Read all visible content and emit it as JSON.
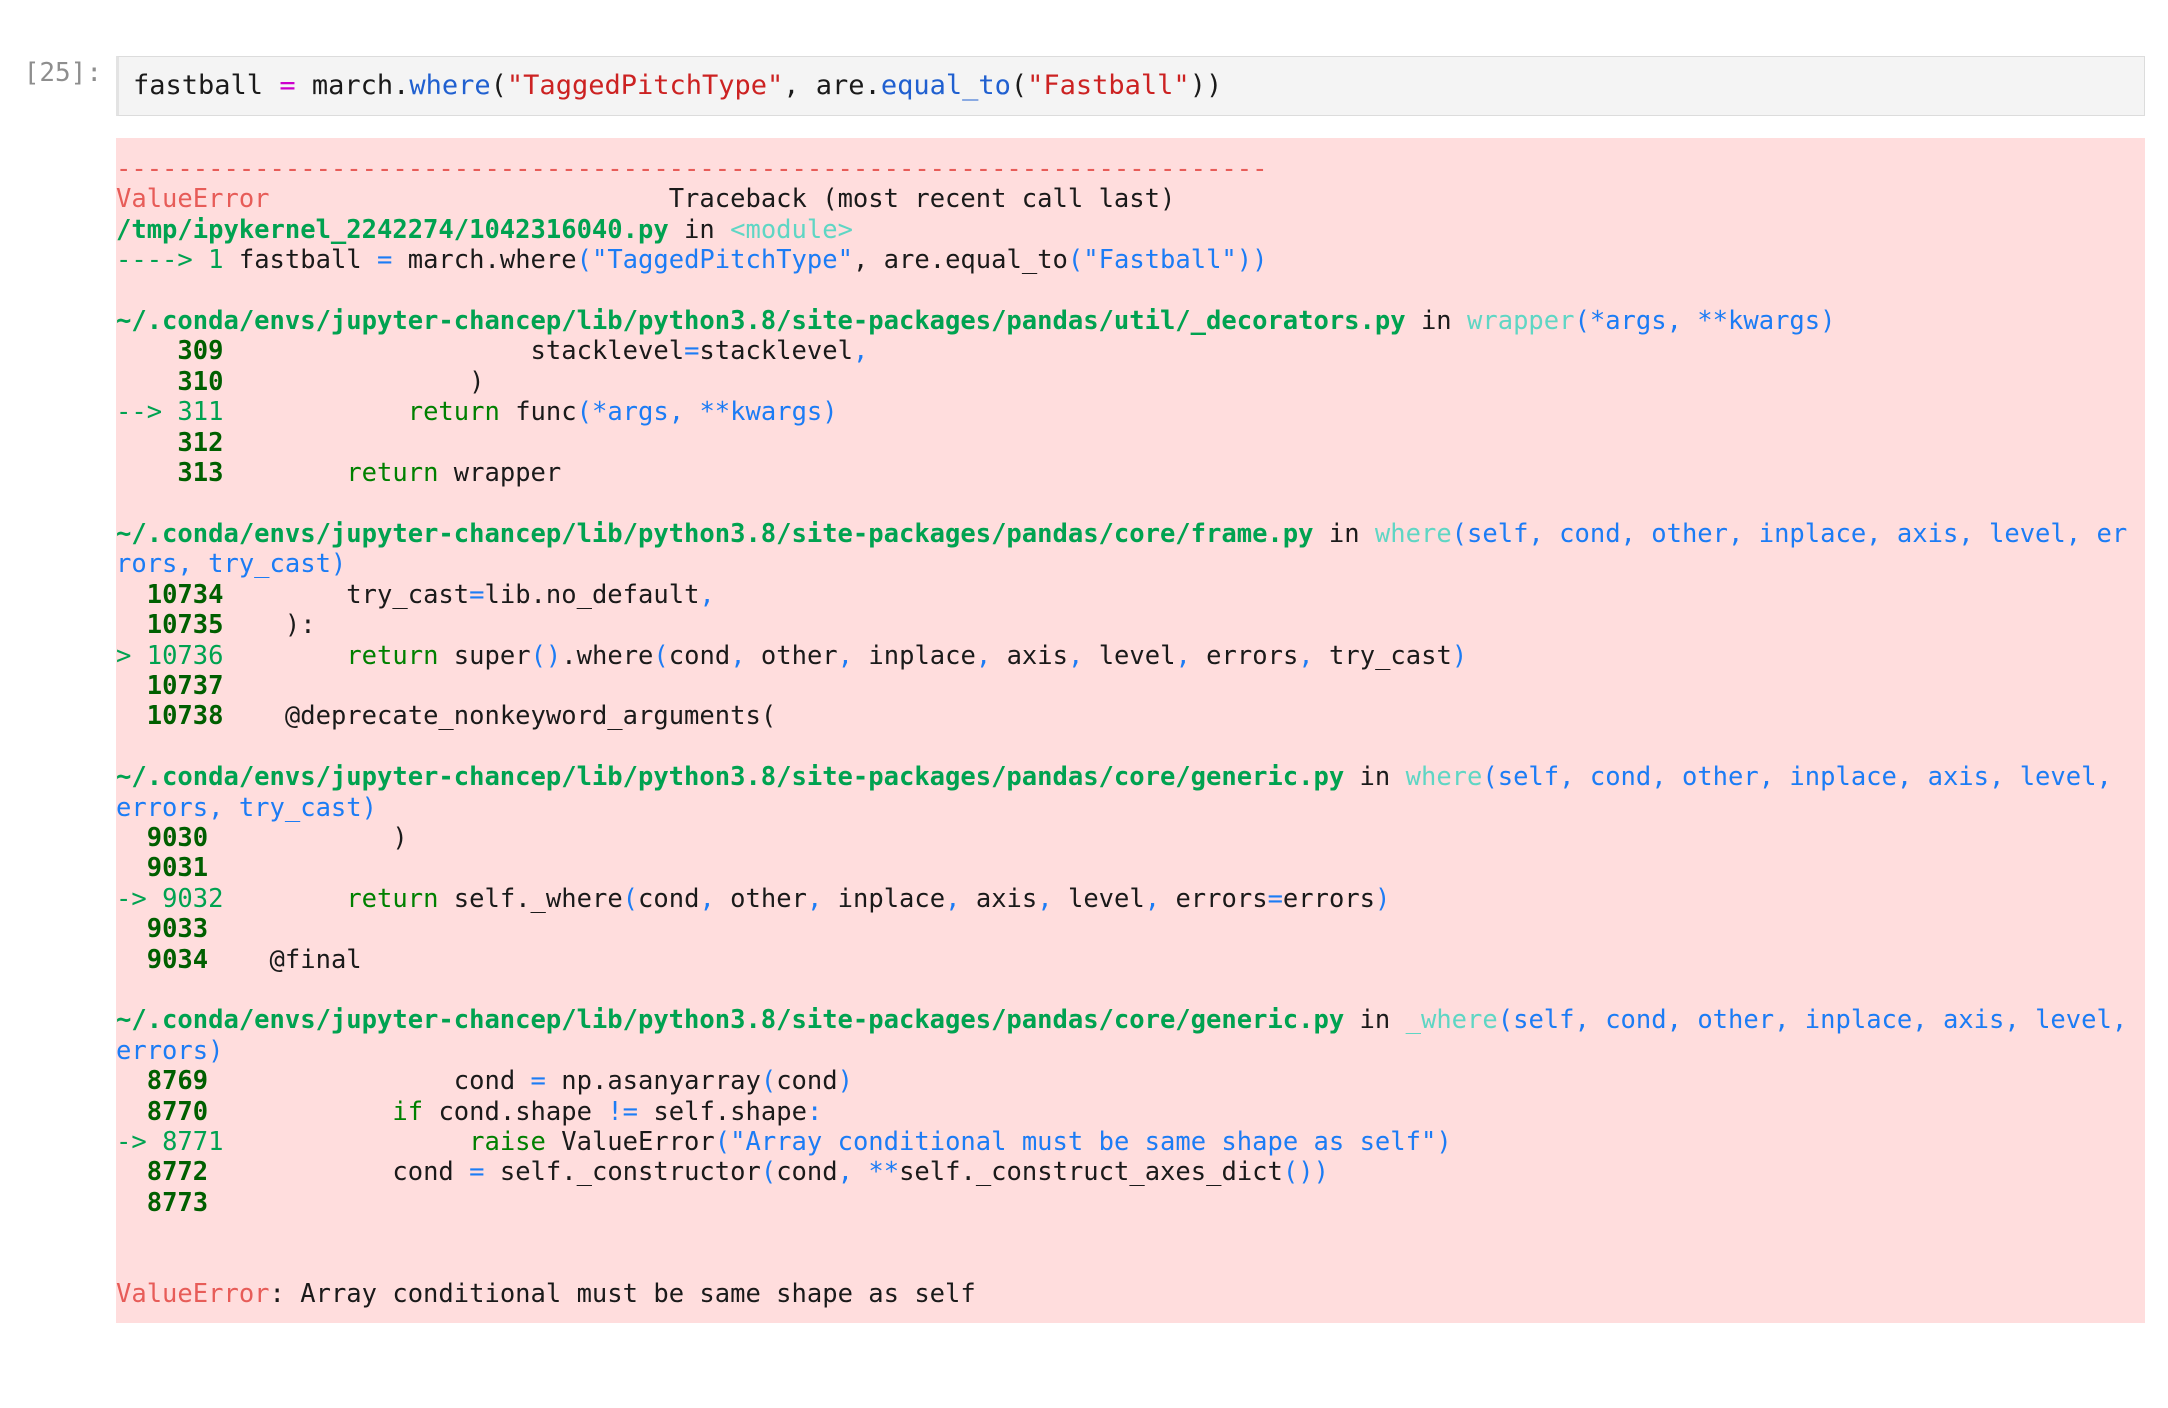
{
  "cell": {
    "prompt": "[25]:",
    "input_code": "fastball = march.where(\"TaggedPitchType\", are.equal_to(\"Fastball\"))",
    "input_tokens": [
      {
        "t": "fastball ",
        "c": "plain"
      },
      {
        "t": "=",
        "c": "magenta"
      },
      {
        "t": " march.",
        "c": "plain"
      },
      {
        "t": "where",
        "c": "kwblue"
      },
      {
        "t": "(",
        "c": "plain"
      },
      {
        "t": "\"TaggedPitchType\"",
        "c": "strred"
      },
      {
        "t": ", are.",
        "c": "plain"
      },
      {
        "t": "equal_to",
        "c": "kwblue"
      },
      {
        "t": "(",
        "c": "plain"
      },
      {
        "t": "\"Fastball\"",
        "c": "strred"
      },
      {
        "t": "))",
        "c": "plain"
      }
    ]
  },
  "traceback": {
    "rule": "---------------------------------------------------------------------------",
    "exception_type": "ValueError",
    "header_right": "Traceback (most recent call last)",
    "final_error_label": "ValueError",
    "final_error_message": ": Array conditional must be same shape as self",
    "frames": [
      {
        "path": "/tmp/ipykernel_2242274/1042316040.py",
        "in_word": " in ",
        "func": "<module>",
        "signature": "",
        "lines": [
          {
            "marker": "----> ",
            "no": "1",
            "current": true,
            "tokens": [
              {
                "t": " fastball ",
                "c": "plain"
              },
              {
                "t": "=",
                "c": "op"
              },
              {
                "t": " march.where",
                "c": "plain"
              },
              {
                "t": "(",
                "c": "op"
              },
              {
                "t": "\"TaggedPitchType\"",
                "c": "arg"
              },
              {
                "t": ", are.equal_to",
                "c": "plain"
              },
              {
                "t": "(",
                "c": "op"
              },
              {
                "t": "\"Fastball\"",
                "c": "arg"
              },
              {
                "t": "))",
                "c": "op"
              }
            ]
          }
        ]
      },
      {
        "path": "~/.conda/envs/jupyter-chancep/lib/python3.8/site-packages/pandas/util/_decorators.py",
        "in_word": " in ",
        "func": "wrapper",
        "signature": "(*args, **kwargs)",
        "lines": [
          {
            "marker": "    ",
            "no": "309",
            "current": false,
            "tokens": [
              {
                "t": "                    stacklevel",
                "c": "plain"
              },
              {
                "t": "=",
                "c": "op"
              },
              {
                "t": "stacklevel",
                "c": "plain"
              },
              {
                "t": ",",
                "c": "op"
              }
            ]
          },
          {
            "marker": "    ",
            "no": "310",
            "current": false,
            "tokens": [
              {
                "t": "                )",
                "c": "plain"
              }
            ]
          },
          {
            "marker": "--> ",
            "no": "311",
            "current": true,
            "tokens": [
              {
                "t": "            ",
                "c": "plain"
              },
              {
                "t": "return",
                "c": "kw"
              },
              {
                "t": " func",
                "c": "plain"
              },
              {
                "t": "(",
                "c": "op"
              },
              {
                "t": "*args",
                "c": "arg"
              },
              {
                "t": ", ",
                "c": "op"
              },
              {
                "t": "**kwargs",
                "c": "arg"
              },
              {
                "t": ")",
                "c": "op"
              }
            ]
          },
          {
            "marker": "    ",
            "no": "312",
            "current": false,
            "tokens": []
          },
          {
            "marker": "    ",
            "no": "313",
            "current": false,
            "tokens": [
              {
                "t": "        ",
                "c": "plain"
              },
              {
                "t": "return",
                "c": "kw"
              },
              {
                "t": " wrapper",
                "c": "plain"
              }
            ]
          }
        ]
      },
      {
        "path": "~/.conda/envs/jupyter-chancep/lib/python3.8/site-packages/pandas/core/frame.py",
        "in_word": " in ",
        "func": "where",
        "signature": "(self, cond, other, inplace, axis, level, errors, try_cast)",
        "lines": [
          {
            "marker": "  ",
            "no": "10734",
            "current": false,
            "tokens": [
              {
                "t": "        try_cast",
                "c": "plain"
              },
              {
                "t": "=",
                "c": "op"
              },
              {
                "t": "lib.no_default",
                "c": "plain"
              },
              {
                "t": ",",
                "c": "op"
              }
            ]
          },
          {
            "marker": "  ",
            "no": "10735",
            "current": false,
            "tokens": [
              {
                "t": "    ):",
                "c": "plain"
              }
            ]
          },
          {
            "marker": "> ",
            "no": "10736",
            "current": true,
            "tokens": [
              {
                "t": "        ",
                "c": "plain"
              },
              {
                "t": "return",
                "c": "kw"
              },
              {
                "t": " super",
                "c": "plain"
              },
              {
                "t": "()",
                "c": "op"
              },
              {
                "t": ".where",
                "c": "plain"
              },
              {
                "t": "(",
                "c": "op"
              },
              {
                "t": "cond",
                "c": "plain"
              },
              {
                "t": ",",
                "c": "op"
              },
              {
                "t": " other",
                "c": "plain"
              },
              {
                "t": ",",
                "c": "op"
              },
              {
                "t": " inplace",
                "c": "plain"
              },
              {
                "t": ",",
                "c": "op"
              },
              {
                "t": " axis",
                "c": "plain"
              },
              {
                "t": ",",
                "c": "op"
              },
              {
                "t": " level",
                "c": "plain"
              },
              {
                "t": ",",
                "c": "op"
              },
              {
                "t": " errors",
                "c": "plain"
              },
              {
                "t": ",",
                "c": "op"
              },
              {
                "t": " try_cast",
                "c": "plain"
              },
              {
                "t": ")",
                "c": "op"
              }
            ]
          },
          {
            "marker": "  ",
            "no": "10737",
            "current": false,
            "tokens": []
          },
          {
            "marker": "  ",
            "no": "10738",
            "current": false,
            "tokens": [
              {
                "t": "    @deprecate_nonkeyword_arguments(",
                "c": "plain"
              }
            ]
          }
        ]
      },
      {
        "path": "~/.conda/envs/jupyter-chancep/lib/python3.8/site-packages/pandas/core/generic.py",
        "in_word": " in ",
        "func": "where",
        "signature": "(self, cond, other, inplace, axis, level, errors, try_cast)",
        "lines": [
          {
            "marker": "  ",
            "no": "9030",
            "current": false,
            "tokens": [
              {
                "t": "            )",
                "c": "plain"
              }
            ]
          },
          {
            "marker": "  ",
            "no": "9031",
            "current": false,
            "tokens": []
          },
          {
            "marker": "-> ",
            "no": "9032",
            "current": true,
            "tokens": [
              {
                "t": "        ",
                "c": "plain"
              },
              {
                "t": "return",
                "c": "kw"
              },
              {
                "t": " self._where",
                "c": "plain"
              },
              {
                "t": "(",
                "c": "op"
              },
              {
                "t": "cond",
                "c": "plain"
              },
              {
                "t": ",",
                "c": "op"
              },
              {
                "t": " other",
                "c": "plain"
              },
              {
                "t": ",",
                "c": "op"
              },
              {
                "t": " inplace",
                "c": "plain"
              },
              {
                "t": ",",
                "c": "op"
              },
              {
                "t": " axis",
                "c": "plain"
              },
              {
                "t": ",",
                "c": "op"
              },
              {
                "t": " level",
                "c": "plain"
              },
              {
                "t": ",",
                "c": "op"
              },
              {
                "t": " errors",
                "c": "plain"
              },
              {
                "t": "=",
                "c": "op"
              },
              {
                "t": "errors",
                "c": "plain"
              },
              {
                "t": ")",
                "c": "op"
              }
            ]
          },
          {
            "marker": "  ",
            "no": "9033",
            "current": false,
            "tokens": []
          },
          {
            "marker": "  ",
            "no": "9034",
            "current": false,
            "tokens": [
              {
                "t": "    @final",
                "c": "plain"
              }
            ]
          }
        ]
      },
      {
        "path": "~/.conda/envs/jupyter-chancep/lib/python3.8/site-packages/pandas/core/generic.py",
        "in_word": " in ",
        "func": "_where",
        "signature": "(self, cond, other, inplace, axis, level, errors)",
        "lines": [
          {
            "marker": "  ",
            "no": "8769",
            "current": false,
            "tokens": [
              {
                "t": "                cond ",
                "c": "plain"
              },
              {
                "t": "=",
                "c": "op"
              },
              {
                "t": " np.asanyarray",
                "c": "plain"
              },
              {
                "t": "(",
                "c": "op"
              },
              {
                "t": "cond",
                "c": "plain"
              },
              {
                "t": ")",
                "c": "op"
              }
            ]
          },
          {
            "marker": "  ",
            "no": "8770",
            "current": false,
            "tokens": [
              {
                "t": "            ",
                "c": "plain"
              },
              {
                "t": "if",
                "c": "kw"
              },
              {
                "t": " cond.shape ",
                "c": "plain"
              },
              {
                "t": "!=",
                "c": "op"
              },
              {
                "t": " self.shape",
                "c": "plain"
              },
              {
                "t": ":",
                "c": "op"
              }
            ]
          },
          {
            "marker": "-> ",
            "no": "8771",
            "current": true,
            "tokens": [
              {
                "t": "                ",
                "c": "plain"
              },
              {
                "t": "raise",
                "c": "kw"
              },
              {
                "t": " ValueError",
                "c": "plain"
              },
              {
                "t": "(",
                "c": "op"
              },
              {
                "t": "\"Array conditional must be same shape as self\"",
                "c": "arg"
              },
              {
                "t": ")",
                "c": "op"
              }
            ]
          },
          {
            "marker": "  ",
            "no": "8772",
            "current": false,
            "tokens": [
              {
                "t": "            cond ",
                "c": "plain"
              },
              {
                "t": "=",
                "c": "op"
              },
              {
                "t": " self._constructor",
                "c": "plain"
              },
              {
                "t": "(",
                "c": "op"
              },
              {
                "t": "cond",
                "c": "plain"
              },
              {
                "t": ",",
                "c": "op"
              },
              {
                "t": " ",
                "c": "plain"
              },
              {
                "t": "**",
                "c": "arg"
              },
              {
                "t": "self._construct_axes_dict",
                "c": "plain"
              },
              {
                "t": "())",
                "c": "op"
              }
            ]
          },
          {
            "marker": "  ",
            "no": "8773",
            "current": false,
            "tokens": []
          }
        ]
      }
    ]
  }
}
